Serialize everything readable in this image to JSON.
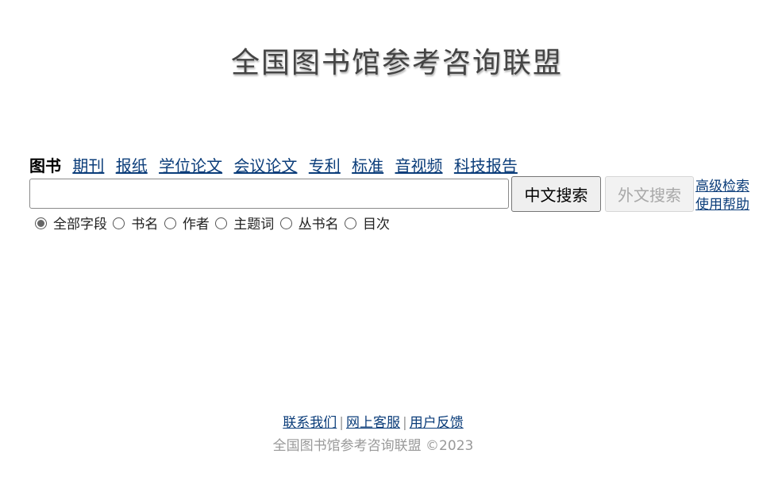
{
  "header": {
    "logo_text": "全国图书馆参考咨询联盟"
  },
  "channels": [
    {
      "label": "图书",
      "active": true
    },
    {
      "label": "期刊"
    },
    {
      "label": "报纸"
    },
    {
      "label": "学位论文"
    },
    {
      "label": "会议论文"
    },
    {
      "label": "专利"
    },
    {
      "label": "标准"
    },
    {
      "label": "音视频"
    },
    {
      "label": "科技报告"
    }
  ],
  "search": {
    "value": "",
    "placeholder": "",
    "chinese_button": "中文搜索",
    "foreign_button": "外文搜索",
    "advanced_link": "高级检索",
    "help_link": "使用帮助"
  },
  "field_options": [
    {
      "label": "全部字段",
      "checked": true
    },
    {
      "label": "书名"
    },
    {
      "label": "作者"
    },
    {
      "label": "主题词"
    },
    {
      "label": "丛书名"
    },
    {
      "label": "目次"
    }
  ],
  "footer": {
    "links": [
      "联系我们",
      "网上客服",
      "用户反馈"
    ],
    "separator": "|",
    "copyright": "全国图书馆参考咨询联盟 ©2023"
  },
  "colors": {
    "link": "#0b3d7a",
    "muted": "#999999"
  }
}
